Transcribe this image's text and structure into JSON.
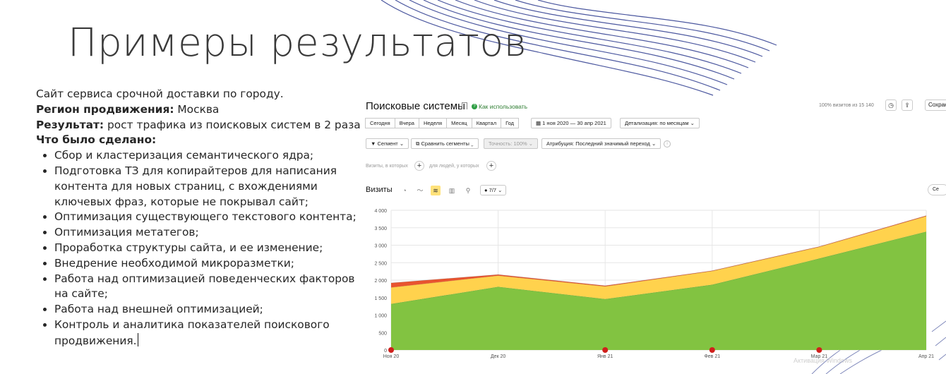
{
  "slide": {
    "title": "Примеры результатов",
    "line1": "Сайт сервиса срочной доставки по городу.",
    "region_label": "Регион продвижения:",
    "region_value": "Москва",
    "result_label": "Результат:",
    "result_value": "рост трафика из поисковых систем в 2 раза",
    "done_label": "Что было сделано:",
    "items": [
      "Сбор и кластеризация семантического ядра;",
      "Подготовка ТЗ для копирайтеров для написания контента для новых страниц, с вхождениями ключевых фраз, которые не покрывал сайт;",
      "Оптимизация существующего текстового контента;",
      "Оптимизация метатегов;",
      "Проработка структуры сайта, и ее изменение;",
      "Внедрение необходимой микроразметки;",
      "Работа над оптимизацией поведенческих факторов на сайте;",
      "Работа над внешней оптимизацией;",
      "Контроль и аналитика показателей поискового продвижения."
    ]
  },
  "panel": {
    "title": "Поисковые системы",
    "how_to": "Как использовать",
    "visits_total": "100% визитов из 15 140",
    "save_label": "Сохран",
    "period_tabs": [
      "Сегодня",
      "Вчера",
      "Неделя",
      "Месяц",
      "Квартал",
      "Год"
    ],
    "date_range": "1 ноя 2020 — 30 апр 2021",
    "detail": "Детализация: по месяцам",
    "segment": "Сегмент",
    "compare": "Сравнить сегменты",
    "accuracy": "Точность: 100%",
    "attribution": "Атрибуция: Последний значимый переход",
    "hint_visits": "Визиты, в которых",
    "hint_people": "для людей, у которых",
    "metric_label": "Визиты",
    "series_count": "7/7",
    "edge_label": "Се",
    "icons": {
      "bookmark": "bookmark-icon",
      "clock": "clock-icon",
      "export": "export-icon",
      "calendar": "calendar-icon",
      "filter": "filter-icon",
      "compare": "compare-icon",
      "info": "info-icon",
      "plus": "plus-icon",
      "chart_types": [
        "pie-icon",
        "line-icon",
        "area-icon",
        "bar-icon",
        "map-icon"
      ],
      "comment": "comment-icon"
    }
  },
  "chart_data": {
    "type": "area",
    "stacked": true,
    "x": [
      "Ноя 20",
      "Дек 20",
      "Янв 21",
      "Фев 21",
      "Мар 21",
      "Апр 21"
    ],
    "yticks": [
      "0",
      "500",
      "1 000",
      "1 500",
      "2 000",
      "2 500",
      "3 000",
      "3 500",
      "4 000"
    ],
    "ylim": [
      0,
      4000
    ],
    "series": [
      {
        "color": "#82c341",
        "values": [
          1320,
          1810,
          1460,
          1870,
          2620,
          3390
        ]
      },
      {
        "color": "#ffd24d",
        "values": [
          470,
          320,
          360,
          390,
          330,
          440
        ]
      },
      {
        "color": "#e8542f",
        "values": [
          130,
          30,
          20,
          10,
          10,
          15
        ]
      }
    ],
    "event_marker_color": "#d0201c",
    "watermark": "Активация Windows",
    "grid": true
  }
}
